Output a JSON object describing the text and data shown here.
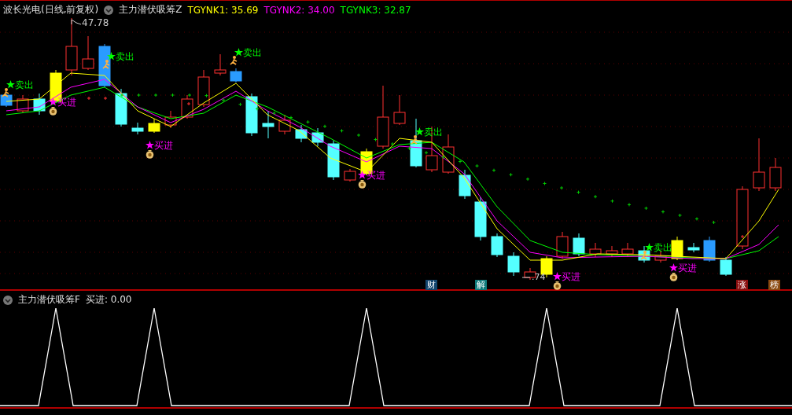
{
  "header": {
    "title": "波长光电(日线,前复权)",
    "indicator": "主力潜伏吸筹Z",
    "readings": [
      {
        "label": "TGYNK1: 35.69",
        "color": "#ffff00"
      },
      {
        "label": "TGYNK2: 34.00",
        "color": "#ff00ff"
      },
      {
        "label": "TGYNK3: 32.87",
        "color": "#00ff00"
      }
    ]
  },
  "price_chart": {
    "high_label": "47.78",
    "low_label": ".74",
    "signals": [
      {
        "kind": "sell",
        "text": "卖出"
      },
      {
        "kind": "buy",
        "text": "买进"
      },
      {
        "kind": "sell",
        "text": "卖出"
      },
      {
        "kind": "buy",
        "text": "买进"
      },
      {
        "kind": "sell",
        "text": "卖出"
      },
      {
        "kind": "buy",
        "text": "买进"
      },
      {
        "kind": "sell",
        "text": "卖出"
      },
      {
        "kind": "buy",
        "text": "买进"
      },
      {
        "kind": "sell",
        "text": "卖出"
      },
      {
        "kind": "buy",
        "text": "买进"
      }
    ],
    "badges": [
      {
        "text": "财",
        "color": "#13466e"
      },
      {
        "text": "解",
        "color": "#0f7a7a"
      },
      {
        "text": "涨",
        "color": "#8b0f0f"
      },
      {
        "text": "榜",
        "color": "#8b4a10"
      }
    ]
  },
  "sub_panel": {
    "indicator": "主力潜伏吸筹F",
    "reading": "买进: 0.00"
  }
}
